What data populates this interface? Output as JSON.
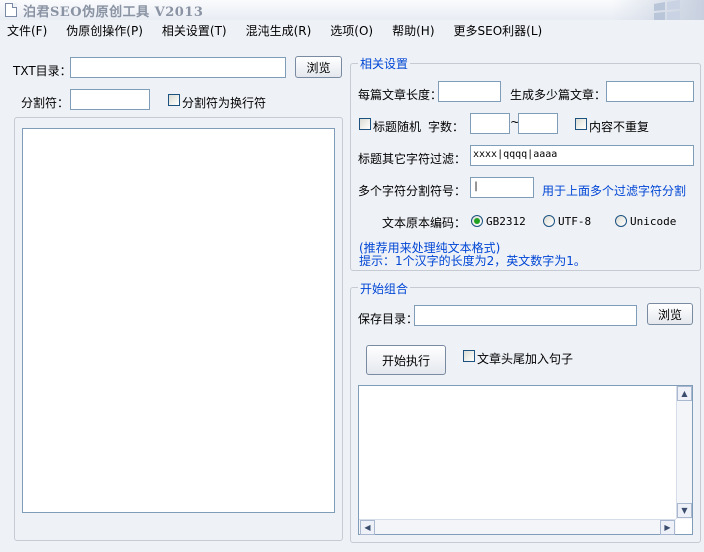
{
  "window": {
    "title": "泊君SEO伪原创工具  V2013"
  },
  "menu": [
    {
      "label": "文件(F)"
    },
    {
      "label": "伪原创操作(P)"
    },
    {
      "label": "相关设置(T)"
    },
    {
      "label": "混沌生成(R)"
    },
    {
      "label": "选项(O)"
    },
    {
      "label": "帮助(H)"
    },
    {
      "label": "更多SEO利器(L)"
    }
  ],
  "left": {
    "txt_dir_label": "TXT目录：",
    "txt_dir_value": "",
    "browse_label": "浏览",
    "separator_label": "分割符：",
    "separator_value": "",
    "separator_newline_label": "分割符为换行符",
    "separator_newline_checked": false
  },
  "settings": {
    "group_title": "相关设置",
    "article_length_label": "每篇文章长度：",
    "article_length_value": "",
    "article_count_label": "生成多少篇文章：",
    "article_count_value": "",
    "random_title_label": "标题随机",
    "random_title_checked": false,
    "word_count_label": "字数：",
    "word_min": "",
    "tilde": "~",
    "word_max": "",
    "no_duplicate_label": "内容不重复",
    "no_duplicate_checked": false,
    "title_filter_label": "标题其它字符过滤：",
    "title_filter_value": "xxxx|qqqq|aaaa",
    "multi_sep_label": "多个字符分割符号：",
    "multi_sep_value": "|",
    "multi_sep_hint": "用于上面多个过滤字符分割",
    "encoding_label": "文本原本编码：",
    "encodings": [
      "GB2312",
      "UTF-8",
      "Unicode"
    ],
    "encoding_selected": "GB2312",
    "note_line1": "(推荐用来处理纯文本格式)",
    "note_line2": "提示：1个汉字的长度为2，英文数字为1。"
  },
  "combine": {
    "group_title": "开始组合",
    "save_dir_label": "保存目录：",
    "save_dir_value": "",
    "browse_label": "浏览",
    "start_label": "开始执行",
    "add_sentence_label": "文章头尾加入句子",
    "add_sentence_checked": false,
    "log_text": ""
  }
}
